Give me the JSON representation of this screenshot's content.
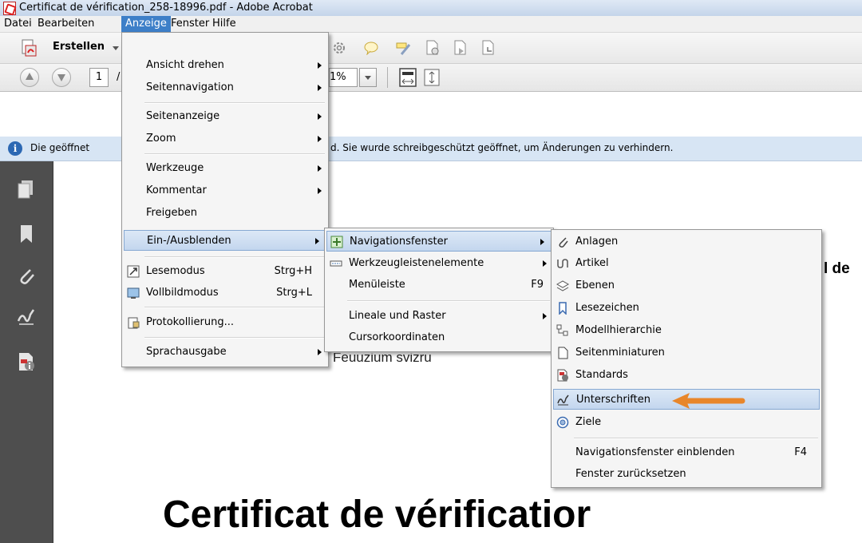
{
  "window": {
    "title": "Certificat de vérification_258-18996.pdf - Adobe Acrobat"
  },
  "menubar": [
    "Datei",
    "Bearbeiten",
    "Anzeige",
    "Fenster",
    "Hilfe"
  ],
  "toolbar": {
    "create_label": "Erstellen",
    "page_number": "1",
    "page_sep": "/",
    "zoom_fragment": "1%"
  },
  "infobar": {
    "message_start": "Die geöffnet",
    "message_end": "d. Sie wurde schreibgeschützt geöffnet, um Änderungen zu verhindern."
  },
  "document": {
    "fragment_right": "l de",
    "fragment_mid": "Feuuzium svizru",
    "heading": "Certificat de vérificatior"
  },
  "menu_anzeige": [
    {
      "label": "Ansicht drehen",
      "submenu": true
    },
    {
      "label": "Seitennavigation",
      "submenu": true
    },
    {
      "label": "Seitenanzeige",
      "submenu": true
    },
    {
      "label": "Zoom",
      "submenu": true
    },
    {
      "label": "Werkzeuge",
      "submenu": true
    },
    {
      "label": "Kommentar",
      "submenu": true
    },
    {
      "label": "Freigeben",
      "submenu": false
    },
    {
      "label": "Ein-/Ausblenden",
      "submenu": true,
      "highlighted": true
    },
    {
      "label": "Lesemodus",
      "shortcut": "Strg+H",
      "icon": "read-mode-icon"
    },
    {
      "label": "Vollbildmodus",
      "shortcut": "Strg+L",
      "icon": "fullscreen-icon"
    },
    {
      "label": "Protokollierung...",
      "icon": "protocol-icon"
    },
    {
      "label": "Sprachausgabe",
      "submenu": true
    }
  ],
  "menu_einaus": [
    {
      "label": "Navigationsfenster",
      "submenu": true,
      "highlighted": true,
      "icon": "navigation-pane-icon"
    },
    {
      "label": "Werkzeugleistenelemente",
      "submenu": true,
      "icon": "toolbar-items-icon"
    },
    {
      "label": "Menüleiste",
      "shortcut": "F9"
    },
    {
      "label": "Lineale und Raster",
      "submenu": true
    },
    {
      "label": "Cursorkoordinaten"
    }
  ],
  "menu_navfenster": [
    {
      "label": "Anlagen",
      "icon": "paperclip-icon"
    },
    {
      "label": "Artikel",
      "icon": "article-icon"
    },
    {
      "label": "Ebenen",
      "icon": "layers-icon"
    },
    {
      "label": "Lesezeichen",
      "icon": "bookmark-icon"
    },
    {
      "label": "Modellhierarchie",
      "icon": "model-tree-icon"
    },
    {
      "label": "Seitenminiaturen",
      "icon": "page-thumbnails-icon"
    },
    {
      "label": "Standards",
      "icon": "standards-icon"
    },
    {
      "label": "Unterschriften",
      "icon": "signature-icon",
      "highlighted": true
    },
    {
      "label": "Ziele",
      "icon": "destinations-icon"
    },
    {
      "label": "Navigationsfenster einblenden",
      "shortcut": "F4"
    },
    {
      "label": "Fenster zurücksetzen"
    }
  ],
  "colors": {
    "menu_highlight": "#c3d6ee",
    "arrow": "#e8862a",
    "left_panel": "#4e4e4e",
    "info_bar": "#d7e5f4"
  }
}
